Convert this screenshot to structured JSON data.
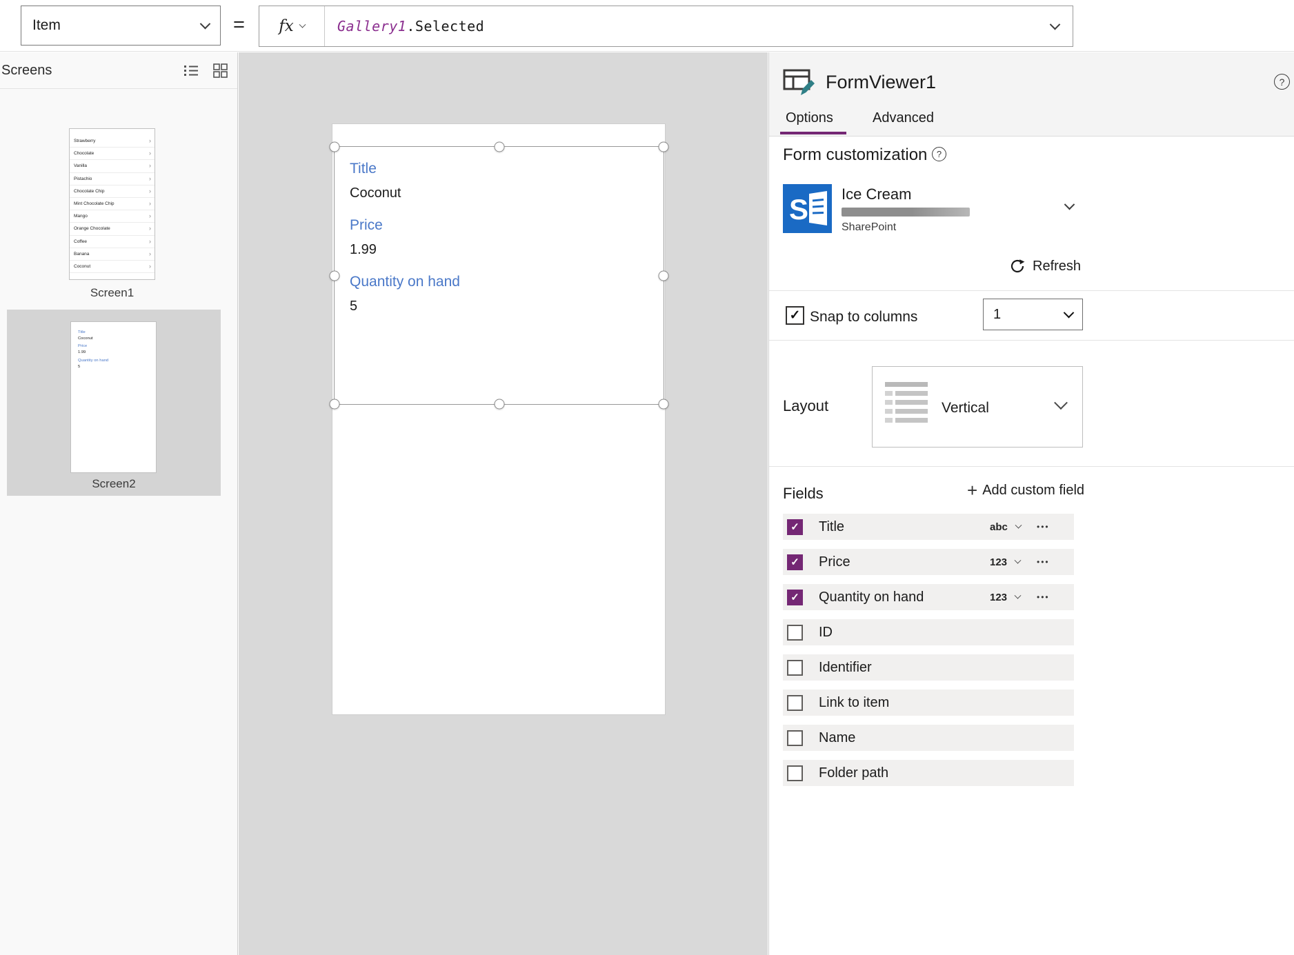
{
  "toolbar": {
    "property": "Item",
    "equals": "=",
    "fx": "fx",
    "formula": {
      "object": "Gallery1",
      "member": ".Selected"
    }
  },
  "icons": {
    "check": "✓",
    "chevron_right": "›",
    "menu_dots": "•••",
    "plus": "+",
    "help": "?"
  },
  "screens_panel": {
    "title": "Screens",
    "screens": [
      {
        "label": "Screen1"
      },
      {
        "label": "Screen2"
      }
    ],
    "screen1_items": [
      "Strawberry",
      "Chocolate",
      "Vanilla",
      "Pistachio",
      "Chocolate Chip",
      "Mint Chocolate Chip",
      "Mango",
      "Orange Chocolate",
      "Coffee",
      "Banana",
      "Coconut"
    ]
  },
  "canvas": {
    "form_fields": [
      {
        "label": "Title",
        "value": "Coconut"
      },
      {
        "label": "Price",
        "value": "1.99"
      },
      {
        "label": "Quantity on hand",
        "value": "5"
      }
    ]
  },
  "inspector": {
    "title": "FormViewer1",
    "tabs": {
      "options": "Options",
      "advanced": "Advanced"
    },
    "form_customization": {
      "heading": "Form customization",
      "source_name": "Ice Cream",
      "source_type": "SharePoint",
      "refresh": "Refresh",
      "snap_label": "Snap to columns",
      "columns": "1",
      "layout_label": "Layout",
      "layout_value": "Vertical"
    },
    "fields": {
      "heading": "Fields",
      "add_custom": "Add custom field",
      "rows": [
        {
          "name": "Title",
          "checked": true,
          "type": "abc"
        },
        {
          "name": "Price",
          "checked": true,
          "type": "123"
        },
        {
          "name": "Quantity on hand",
          "checked": true,
          "type": "123"
        },
        {
          "name": "ID",
          "checked": false
        },
        {
          "name": "Identifier",
          "checked": false
        },
        {
          "name": "Link to item",
          "checked": false
        },
        {
          "name": "Name",
          "checked": false
        },
        {
          "name": "Folder path",
          "checked": false
        }
      ]
    }
  },
  "colors": {
    "accent_purple": "#742774",
    "label_blue": "#4a78c8",
    "sharepoint_blue": "#1a6ac4",
    "canvas_gray": "#d9d9d9"
  }
}
